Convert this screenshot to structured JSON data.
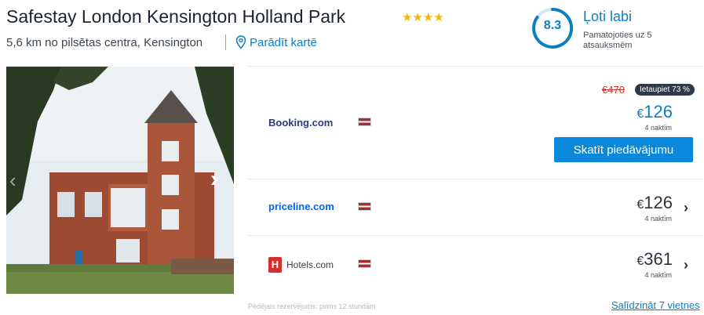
{
  "hotel": {
    "name": "Safestay London Kensington Holland Park",
    "stars": "★★★★",
    "distance": "5,6 km no pilsētas centra, Kensington",
    "map_link": "Parādīt kartē"
  },
  "rating": {
    "score": "8.3",
    "label": "Ļoti labi",
    "basis": "Pamatojoties uz 5 atsauksmēm"
  },
  "offers": [
    {
      "provider": "Booking.com",
      "old_price": "€470",
      "discount_badge": "Ietaupiet 73 %",
      "currency": "€",
      "price": "126",
      "nights": "4 naktīm",
      "cta": "Skatīt piedāvājumu"
    },
    {
      "provider": "priceline.com",
      "currency": "€",
      "price": "126",
      "nights": "4 naktīm"
    },
    {
      "provider": "Hotels.com",
      "currency": "€",
      "price": "361",
      "nights": "4 naktīm"
    }
  ],
  "footer": {
    "last_booking": "Pēdējais rezervējums: pirms 12 stundām",
    "compare_link": "Salīdzināt 7 vietnes"
  },
  "icons": {
    "map_pin": "map-pin-icon",
    "arrow_left": "chevron-left-icon",
    "arrow_right": "chevron-right-icon",
    "offer_arrow": "chevron-right-icon"
  },
  "colors": {
    "accent": "#0a7fc2",
    "button": "#0a88dc",
    "star": "#f5b50a",
    "strike": "#d0342c",
    "booking_blue": "#273b7d",
    "priceline_blue": "#0068ef",
    "hotels_red": "#d32f2f"
  }
}
